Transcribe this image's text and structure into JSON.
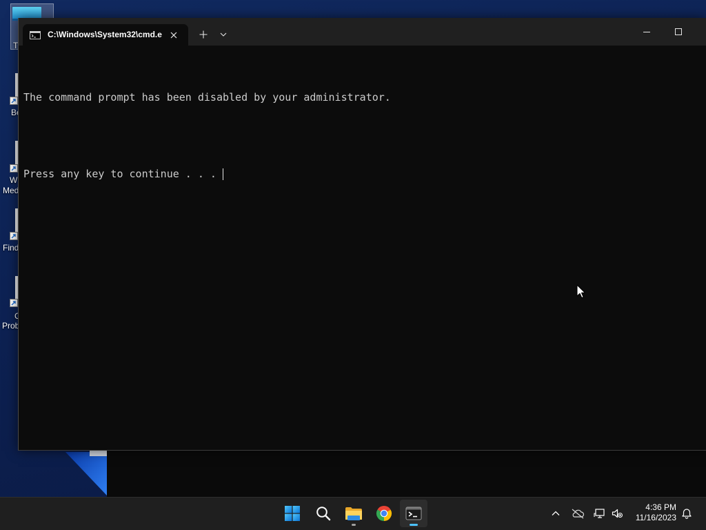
{
  "desktop": {
    "icons": [
      {
        "icon": "this-pc-icon",
        "selected": true,
        "label": [
          "T"
        ]
      },
      {
        "icon": "shortcut-icon",
        "label": [
          "Be"
        ]
      },
      {
        "icon": "shortcut-icon",
        "label": [
          "W",
          "Med"
        ]
      },
      {
        "icon": "shortcut-icon",
        "label": [
          "Find"
        ]
      },
      {
        "icon": "shortcut-icon",
        "label": [
          "C",
          "Prob"
        ]
      }
    ]
  },
  "terminal": {
    "tab": {
      "icon": "cmd-icon",
      "title": "C:\\Windows\\System32\\cmd.e",
      "close_icon": "close-icon"
    },
    "new_tab_icon": "plus-icon",
    "dropdown_icon": "chevron-down-icon",
    "window_controls": [
      "minimize-icon",
      "maximize-icon"
    ],
    "output": [
      "The command prompt has been disabled by your administrator.",
      "Press any key to continue . . . "
    ]
  },
  "taskbar": {
    "apps": [
      {
        "icon": "windows-start-icon",
        "running": false,
        "active": false
      },
      {
        "icon": "search-icon",
        "running": false,
        "active": false
      },
      {
        "icon": "file-explorer-icon",
        "running": true,
        "active": false
      },
      {
        "icon": "chrome-icon",
        "running": false,
        "active": false
      },
      {
        "icon": "terminal-icon",
        "running": true,
        "active": true
      }
    ],
    "tray": {
      "icons": [
        "chevron-up-icon",
        "onedrive-offline-icon",
        "network-icon",
        "volume-muted-icon",
        "notification-bell-icon"
      ],
      "time": "4:36 PM",
      "date": "11/16/2023"
    }
  },
  "colors": {
    "desktop": "#0d2254",
    "terminal_background": "#0c0c0c",
    "terminal_text": "#cccccc",
    "tab_strip": "#202020",
    "taskbar": "#1f1f1f",
    "accent": "#4cc2ff"
  }
}
